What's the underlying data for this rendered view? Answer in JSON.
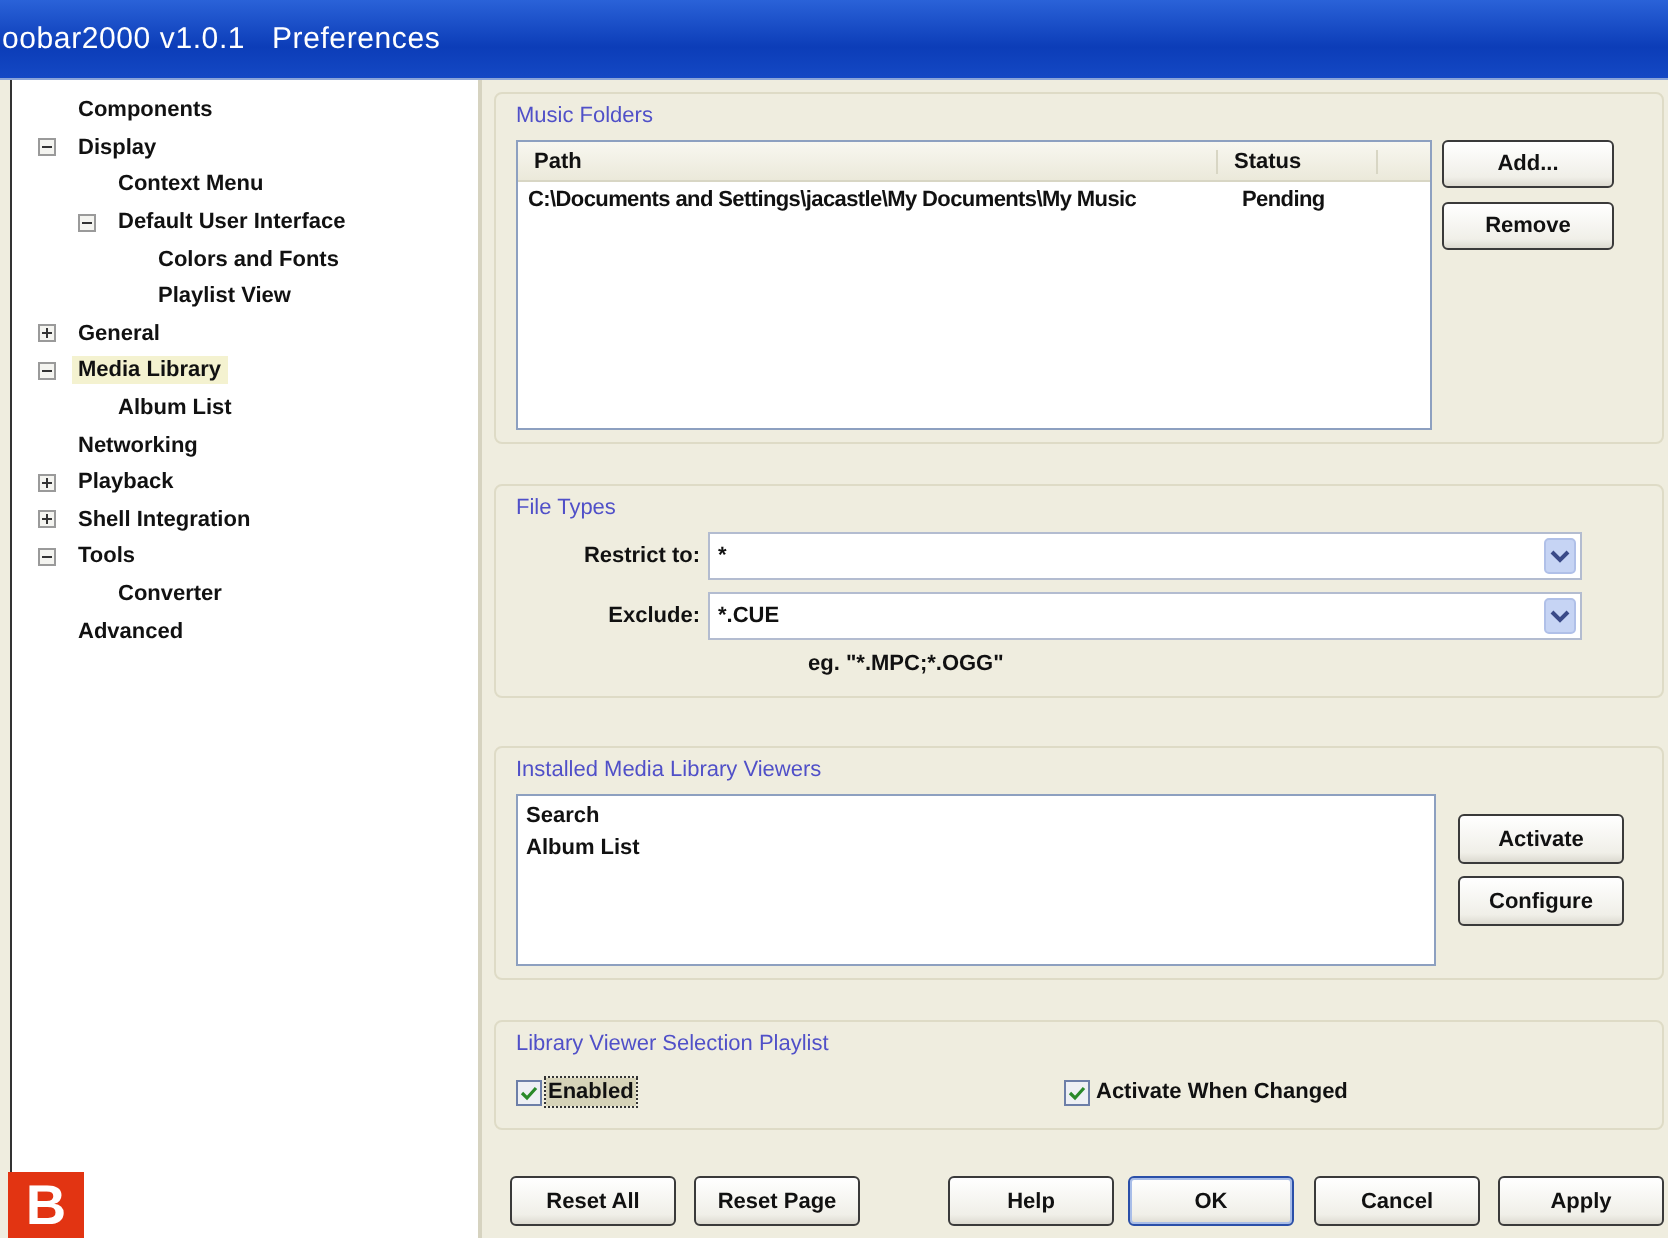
{
  "window": {
    "title": "oobar2000 v1.0.1   Preferences"
  },
  "tree": [
    {
      "label": "Components",
      "selected": false
    },
    {
      "label": "Display",
      "selected": false,
      "expanded": true,
      "children": [
        {
          "label": "Context Menu",
          "selected": false
        },
        {
          "label": "Default User Interface",
          "selected": false,
          "expanded": true,
          "children": [
            {
              "label": "Colors and Fonts",
              "selected": false
            },
            {
              "label": "Playlist View",
              "selected": false
            }
          ]
        }
      ]
    },
    {
      "label": "General",
      "selected": false,
      "expanded": false
    },
    {
      "label": "Media Library",
      "selected": true,
      "expanded": true,
      "children": [
        {
          "label": "Album List",
          "selected": false
        }
      ]
    },
    {
      "label": "Networking",
      "selected": false
    },
    {
      "label": "Playback",
      "selected": false,
      "expanded": false
    },
    {
      "label": "Shell Integration",
      "selected": false,
      "expanded": false
    },
    {
      "label": "Tools",
      "selected": false,
      "expanded": true,
      "children": [
        {
          "label": "Converter",
          "selected": false
        }
      ]
    },
    {
      "label": "Advanced",
      "selected": false
    }
  ],
  "music_folders": {
    "title": "Music Folders",
    "columns": [
      "Path",
      "Status"
    ],
    "rows": [
      {
        "path": "C:\\Documents and Settings\\jacastle\\My Documents\\My Music",
        "status": "Pending"
      }
    ],
    "buttons": [
      "Add...",
      "Remove"
    ]
  },
  "file_types": {
    "title": "File Types",
    "fields": [
      {
        "label": "Restrict to:",
        "value": "*"
      },
      {
        "label": "Exclude:",
        "value": "*.CUE"
      }
    ],
    "hint": "eg. \"*.MPC;*.OGG\""
  },
  "viewers": {
    "title": "Installed Media Library Viewers",
    "items": [
      "Search",
      "Album List"
    ],
    "buttons": [
      "Activate",
      "Configure"
    ]
  },
  "selection_playlist": {
    "title": "Library Viewer Selection Playlist",
    "options": [
      {
        "label": "Enabled",
        "checked": true,
        "focused": true
      },
      {
        "label": "Activate When Changed",
        "checked": true,
        "focused": false
      }
    ]
  },
  "footer_buttons": [
    {
      "label": "Reset All",
      "default": false
    },
    {
      "label": "Reset Page",
      "default": false
    },
    {
      "label": "Help",
      "default": false
    },
    {
      "label": "OK",
      "default": true
    },
    {
      "label": "Cancel",
      "default": false
    },
    {
      "label": "Apply",
      "default": false
    }
  ],
  "figure_label": "B"
}
